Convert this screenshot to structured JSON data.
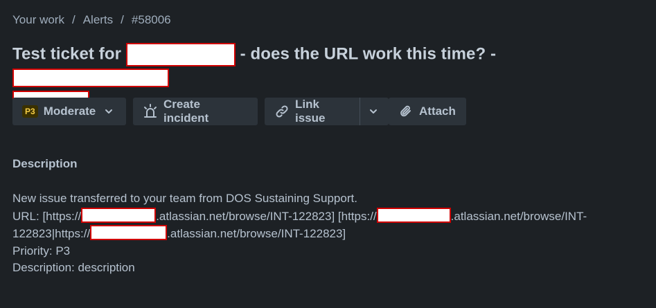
{
  "breadcrumb": {
    "items": [
      "Your work",
      "Alerts",
      "#58006"
    ],
    "separator": "/"
  },
  "title": {
    "part1": "Test ticket for",
    "part2": "- does the URL work this time? -"
  },
  "toolbar": {
    "priority_badge": "P3",
    "priority_label": "Moderate",
    "create_incident_label": "Create incident",
    "link_issue_label": "Link issue",
    "attach_label": "Attach"
  },
  "description": {
    "heading": "Description",
    "line1": "New issue transferred to your team from DOS Sustaining Support.",
    "line2_a": "URL: [https://",
    "line2_b": ".atlassian.net/browse/INT-122823] [https://",
    "line2_c": ".atlassian.net/browse/INT-",
    "line3_a": "122823|https://",
    "line3_b": ".atlassian.net/browse/INT-122823]",
    "line4": "Priority: P3",
    "line5": "Description: description"
  },
  "colors": {
    "background": "#1d2125",
    "button_bg": "#2c333a",
    "text": "#b6c2cf",
    "priority_badge_text": "#f5cd47",
    "redaction_border": "#d00000"
  },
  "icons": [
    "chevron-down-icon",
    "siren-icon",
    "link-icon",
    "paperclip-icon"
  ]
}
